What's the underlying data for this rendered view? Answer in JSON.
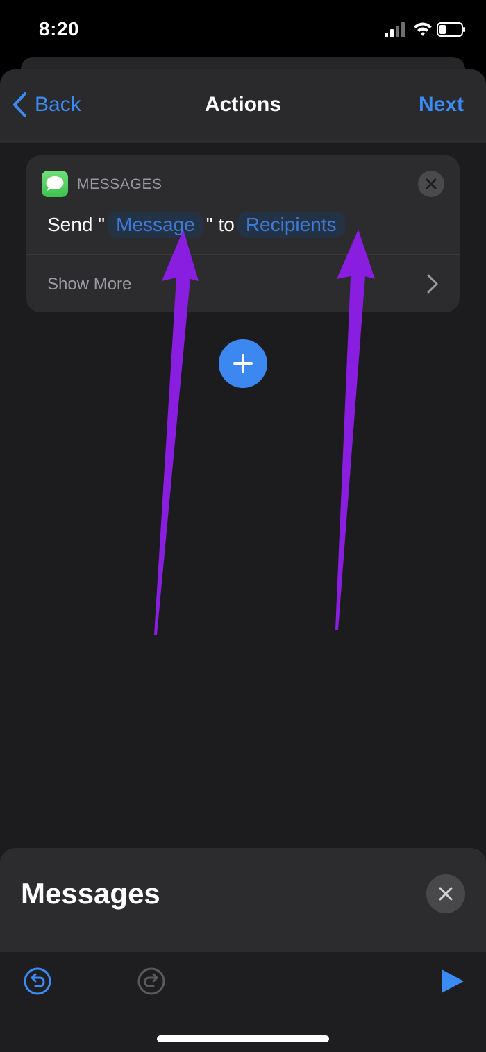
{
  "status_bar": {
    "time": "8:20",
    "icons": [
      "cellular-signal-icon",
      "wifi-icon",
      "battery-icon"
    ]
  },
  "nav": {
    "back_label": "Back",
    "title": "Actions",
    "next_label": "Next"
  },
  "action": {
    "app_name": "MESSAGES",
    "app_icon": "messages-app-icon",
    "sentence_prefix": "Send \"",
    "message_token": "Message",
    "sentence_middle": "\" to",
    "recipients_token": "Recipients",
    "show_more_label": "Show More"
  },
  "annotations": {
    "arrow_color": "#8a1ee0",
    "arrow_count": 2
  },
  "panel": {
    "title": "Messages"
  },
  "toolbar": {
    "icons": [
      "undo-icon",
      "redo-icon",
      "play-icon"
    ]
  },
  "colors": {
    "accent": "#3b8bf5",
    "background": "#1c1c1e",
    "card": "#2c2c2e",
    "token_bg": "#243246"
  }
}
